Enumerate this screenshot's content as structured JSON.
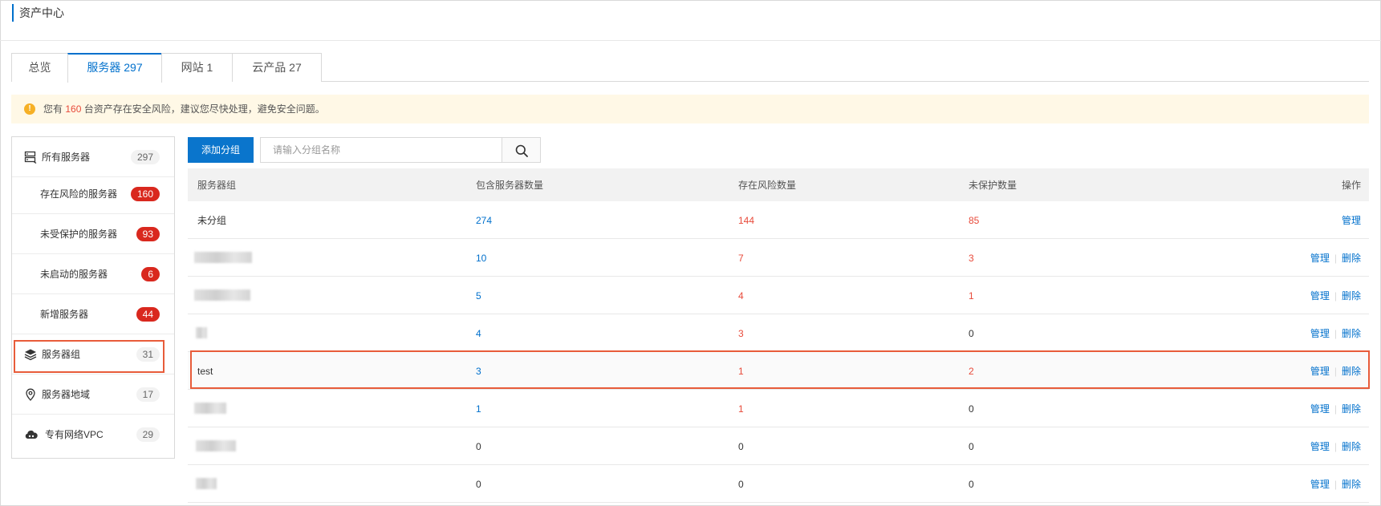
{
  "header": {
    "title": "资产中心"
  },
  "tabs": [
    {
      "label": "总览",
      "active": false
    },
    {
      "label": "服务器 297",
      "active": true
    },
    {
      "label": "网站 1",
      "active": false
    },
    {
      "label": "云产品 27",
      "active": false
    }
  ],
  "alert": {
    "prefix": "您有",
    "count": "160",
    "suffix": "台资产存在安全风险，建议您尽快处理，避免安全问题。"
  },
  "sidebar": {
    "items": [
      {
        "label": "所有服务器",
        "count": "297",
        "icon": "server-list-icon"
      },
      {
        "label": "存在风险的服务器",
        "count": "160"
      },
      {
        "label": "未受保护的服务器",
        "count": "93"
      },
      {
        "label": "未启动的服务器",
        "count": "6"
      },
      {
        "label": "新增服务器",
        "count": "44"
      },
      {
        "label": "服务器组",
        "count": "31",
        "icon": "layers-icon",
        "selected": true
      },
      {
        "label": "服务器地域",
        "count": "17",
        "icon": "location-pin-icon"
      },
      {
        "label": "专有网络VPC",
        "count": "29",
        "icon": "cloud-icon"
      }
    ]
  },
  "toolbar": {
    "add_group_label": "添加分组",
    "search_placeholder": "请输入分组名称"
  },
  "table": {
    "headers": {
      "group": "服务器组",
      "servers": "包含服务器数量",
      "risk": "存在风险数量",
      "unprotected": "未保护数量",
      "actions": "操作"
    },
    "action_manage": "管理",
    "action_delete": "删除",
    "rows": [
      {
        "name": "未分组",
        "servers": "274",
        "risk": "144",
        "unprotected": "85",
        "deletable": false
      },
      {
        "name": "",
        "servers": "10",
        "risk": "7",
        "unprotected": "3",
        "deletable": true
      },
      {
        "name": "",
        "servers": "5",
        "risk": "4",
        "unprotected": "1",
        "deletable": true
      },
      {
        "name": "",
        "servers": "4",
        "risk": "3",
        "unprotected": "0",
        "deletable": true
      },
      {
        "name": "test",
        "servers": "3",
        "risk": "1",
        "unprotected": "2",
        "deletable": true,
        "highlighted": true
      },
      {
        "name": "",
        "servers": "1",
        "risk": "1",
        "unprotected": "0",
        "deletable": true
      },
      {
        "name": "",
        "servers": "0",
        "risk": "0",
        "unprotected": "0",
        "deletable": true
      },
      {
        "name": "",
        "servers": "0",
        "risk": "0",
        "unprotected": "0",
        "deletable": true
      }
    ]
  },
  "colors": {
    "accent": "#0070cc",
    "danger": "#d9281e",
    "risk_text": "#e84a3a",
    "highlight_border": "#e85c3a",
    "alert_bg": "#fff8e6"
  }
}
